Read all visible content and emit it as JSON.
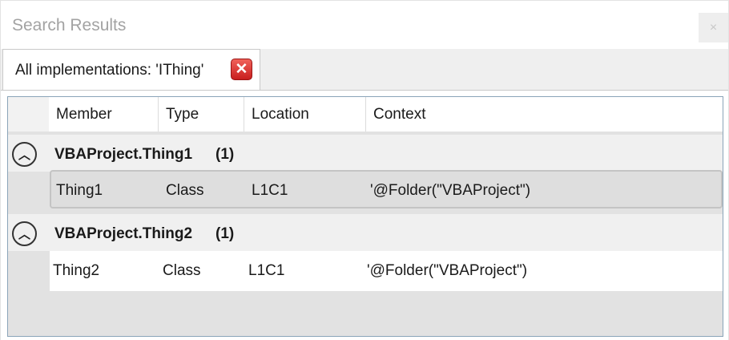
{
  "window": {
    "title": "Search Results",
    "close_glyph": "×"
  },
  "tab": {
    "label": "All implementations: 'IThing'",
    "close_glyph": "✕"
  },
  "columns": [
    "Member",
    "Type",
    "Location",
    "Context"
  ],
  "groups": [
    {
      "title": "VBAProject.Thing1",
      "count": "(1)",
      "expander_glyph": "︿",
      "rows": [
        {
          "member": "Thing1",
          "type": "Class",
          "location": "L1C1",
          "context": "'@Folder(\"VBAProject\")",
          "selected": true
        }
      ]
    },
    {
      "title": "VBAProject.Thing2",
      "count": "(1)",
      "expander_glyph": "︿",
      "rows": [
        {
          "member": "Thing2",
          "type": "Class",
          "location": "L1C1",
          "context": "'@Folder(\"VBAProject\")",
          "selected": false
        }
      ]
    }
  ]
}
